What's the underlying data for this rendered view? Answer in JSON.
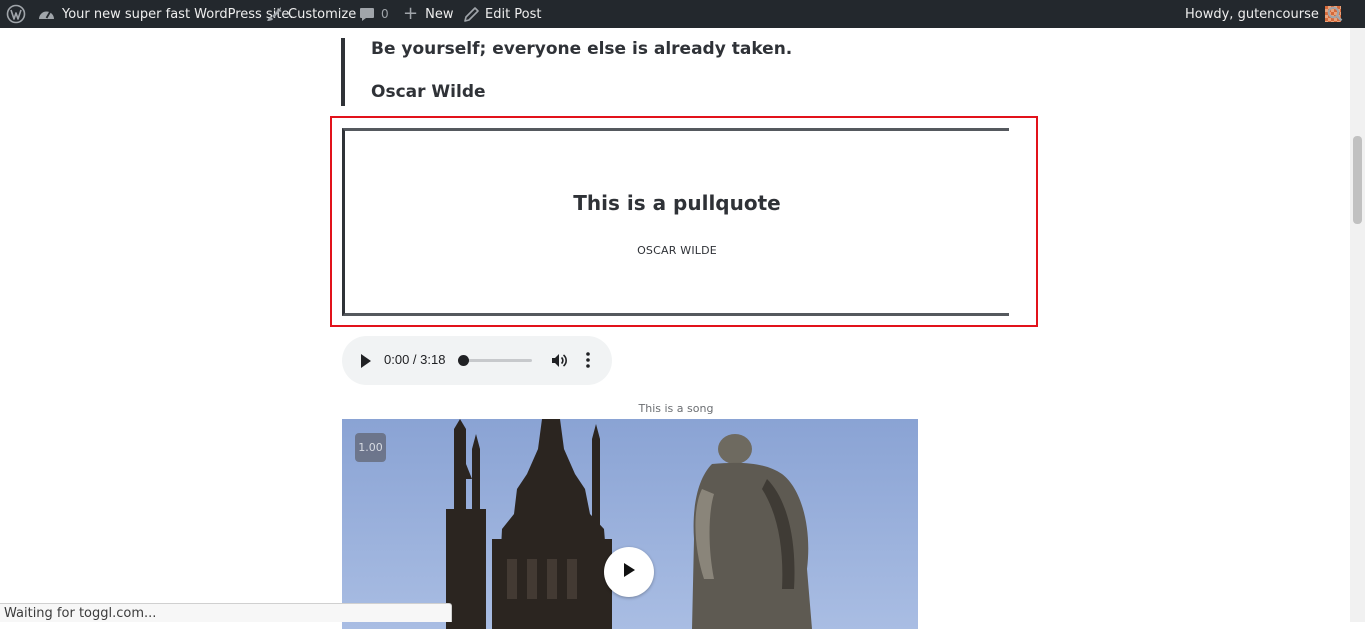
{
  "admin_bar": {
    "site_name": "Your new super fast WordPress site.",
    "customize": "Customize",
    "comments_count": "0",
    "new": "New",
    "edit_post": "Edit Post",
    "howdy": "Howdy, gutencourse"
  },
  "blockquote": {
    "text": "Be yourself; everyone else is already taken.",
    "citation": "Oscar Wilde"
  },
  "pullquote": {
    "text": "This is a pullquote",
    "citation": "OSCAR WILDE"
  },
  "audio": {
    "time": "0:00 / 3:18",
    "progress": 0
  },
  "audio_caption": "This is a song",
  "video": {
    "speed": "1.00"
  },
  "status_bar": "Waiting for toggl.com...",
  "colors": {
    "admin_bar_bg": "#23282d",
    "highlight_border": "#e2121b",
    "text_dark": "#2f3237"
  }
}
